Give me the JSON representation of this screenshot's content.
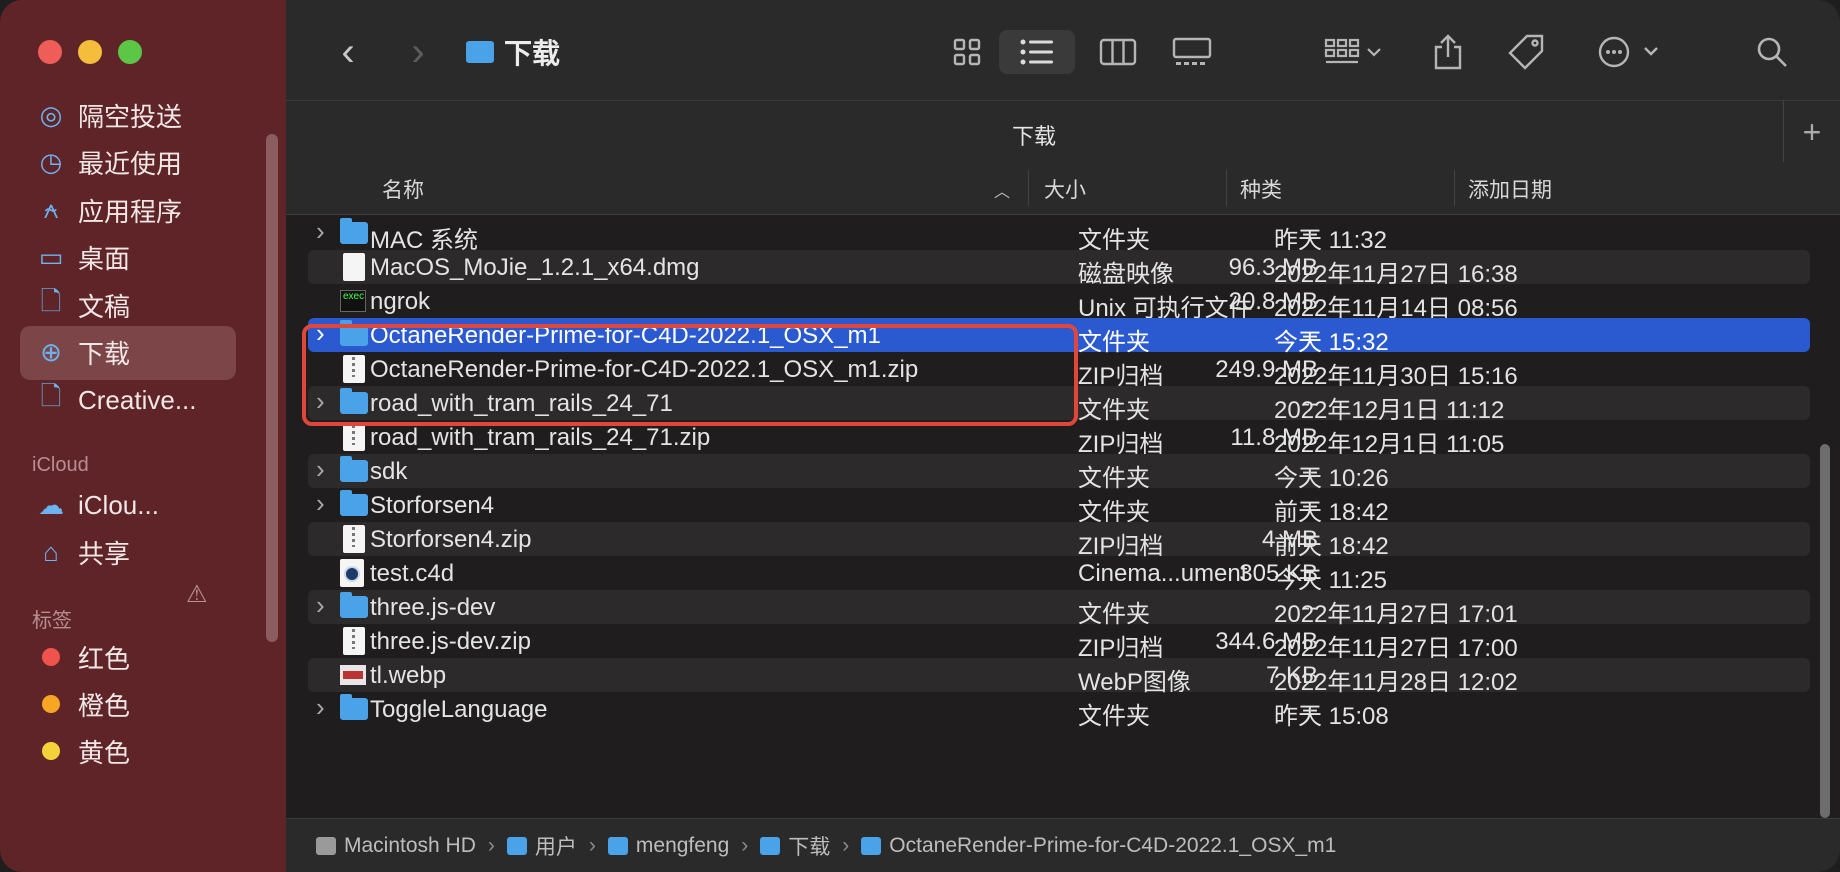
{
  "window": {
    "title": "下载"
  },
  "sidebar": {
    "favorites": [
      {
        "label": "隔空投送",
        "icon": "airdrop-icon"
      },
      {
        "label": "最近使用",
        "icon": "clock-icon"
      },
      {
        "label": "应用程序",
        "icon": "applications-icon"
      },
      {
        "label": "桌面",
        "icon": "desktop-icon"
      },
      {
        "label": "文稿",
        "icon": "document-icon"
      },
      {
        "label": "下载",
        "icon": "download-icon",
        "active": true
      },
      {
        "label": "Creative...",
        "icon": "file-icon"
      }
    ],
    "icloud_section": "iCloud",
    "icloud": [
      {
        "label": "iClou...",
        "icon": "cloud-icon"
      },
      {
        "label": "共享",
        "icon": "shared-folder-icon"
      }
    ],
    "tags_section": "标签",
    "tags": [
      {
        "label": "红色",
        "color": "#f0524d"
      },
      {
        "label": "橙色",
        "color": "#f5a623"
      },
      {
        "label": "黄色",
        "color": "#f5d23a"
      }
    ]
  },
  "toolbar": {
    "folder_title": "下载"
  },
  "tab": {
    "title": "下载",
    "add": "+"
  },
  "columns": {
    "name": "名称",
    "size": "大小",
    "kind": "种类",
    "date": "添加日期"
  },
  "files": [
    {
      "name": "MAC 系统",
      "size": "--",
      "kind": "文件夹",
      "date": "昨天 11:32",
      "type": "folder"
    },
    {
      "name": "MacOS_MoJie_1.2.1_x64.dmg",
      "size": "96.3 MB",
      "kind": "磁盘映像",
      "date": "2022年11月27日 16:38",
      "type": "dmg"
    },
    {
      "name": "ngrok",
      "size": "20.8 MB",
      "kind": "Unix 可执行文件",
      "date": "2022年11月14日 08:56",
      "type": "exec"
    },
    {
      "name": "OctaneRender-Prime-for-C4D-2022.1_OSX_m1",
      "size": "--",
      "kind": "文件夹",
      "date": "今天 15:32",
      "type": "folder",
      "selected": true
    },
    {
      "name": "OctaneRender-Prime-for-C4D-2022.1_OSX_m1.zip",
      "size": "249.9 MB",
      "kind": "ZIP归档",
      "date": "2022年11月30日 15:16",
      "type": "zip"
    },
    {
      "name": "road_with_tram_rails_24_71",
      "size": "--",
      "kind": "文件夹",
      "date": "2022年12月1日 11:12",
      "type": "folder"
    },
    {
      "name": "road_with_tram_rails_24_71.zip",
      "size": "11.8 MB",
      "kind": "ZIP归档",
      "date": "2022年12月1日 11:05",
      "type": "zip"
    },
    {
      "name": "sdk",
      "size": "--",
      "kind": "文件夹",
      "date": "今天 10:26",
      "type": "folder"
    },
    {
      "name": "Storforsen4",
      "size": "--",
      "kind": "文件夹",
      "date": "前天 18:42",
      "type": "folder"
    },
    {
      "name": "Storforsen4.zip",
      "size": "4 MB",
      "kind": "ZIP归档",
      "date": "前天 18:42",
      "type": "zip"
    },
    {
      "name": "test.c4d",
      "size": "305 KB",
      "kind": "Cinema...ument",
      "date": "今天 11:25",
      "type": "c4d"
    },
    {
      "name": "three.js-dev",
      "size": "--",
      "kind": "文件夹",
      "date": "2022年11月27日 17:01",
      "type": "folder"
    },
    {
      "name": "three.js-dev.zip",
      "size": "344.6 MB",
      "kind": "ZIP归档",
      "date": "2022年11月27日 17:00",
      "type": "zip"
    },
    {
      "name": "tl.webp",
      "size": "7 KB",
      "kind": "WebP图像",
      "date": "2022年11月28日 12:02",
      "type": "webp"
    },
    {
      "name": "ToggleLanguage",
      "size": "--",
      "kind": "文件夹",
      "date": "昨天 15:08",
      "type": "folder"
    }
  ],
  "pathbar": [
    {
      "label": "Macintosh HD",
      "color": "#9a9a9a"
    },
    {
      "label": "用户",
      "color": "#4aa3e8"
    },
    {
      "label": "mengfeng",
      "color": "#4aa3e8"
    },
    {
      "label": "下载",
      "color": "#4aa3e8"
    },
    {
      "label": "OctaneRender-Prime-for-C4D-2022.1_OSX_m1",
      "color": "#4aa3e8"
    }
  ],
  "colors": {
    "sidebar_bg": "#5e2427",
    "selection": "#2b5ad0",
    "highlight_box": "#e1463a",
    "folder": "#4aa3e8"
  }
}
